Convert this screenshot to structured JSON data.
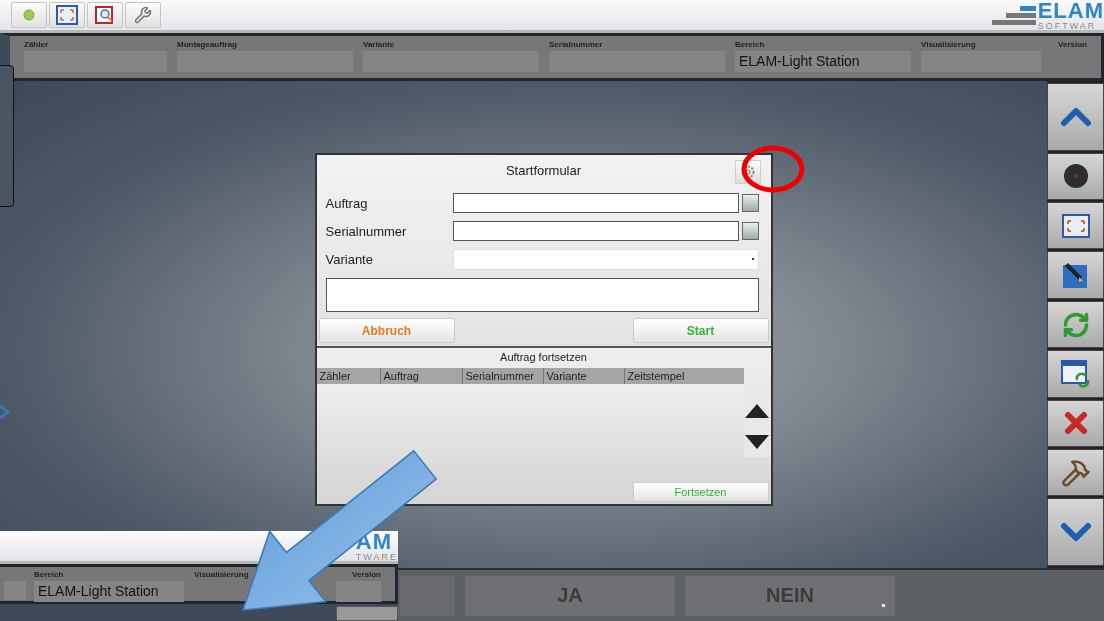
{
  "logo": {
    "name": "ELAM",
    "tagline": "SOFTWAR"
  },
  "info_fields": [
    {
      "label": "Zähler"
    },
    {
      "label": "Montageauftrag"
    },
    {
      "label": "Variante"
    },
    {
      "label": "Serialnummer"
    },
    {
      "label": "Bereich",
      "value": "ELAM-Light Station"
    },
    {
      "label": "Visualisierung"
    },
    {
      "label": "Version"
    }
  ],
  "dialog": {
    "title": "Startformular",
    "fields": [
      {
        "label": "Auftrag",
        "kind": "text"
      },
      {
        "label": "Serialnummer",
        "kind": "text"
      },
      {
        "label": "Variante",
        "kind": "select"
      }
    ],
    "cancel_button": "Abbruch",
    "start_button": "Start",
    "resume": {
      "title": "Auftrag fortsetzen",
      "columns": [
        "Zähler",
        "Auftrag",
        "Serialnummer",
        "Variante",
        "Zeitstempel"
      ],
      "button": "Fortsetzen"
    }
  },
  "bottom_buttons": [
    "JA",
    "NEIN"
  ],
  "inset": {
    "logo_fragment": "AM",
    "tagline_fragment": "TWARE",
    "fields": [
      {
        "label": "Bereich",
        "value": "ELAM-Light Station"
      },
      {
        "label": "Visualisierung"
      },
      {
        "label": "Version"
      }
    ]
  }
}
